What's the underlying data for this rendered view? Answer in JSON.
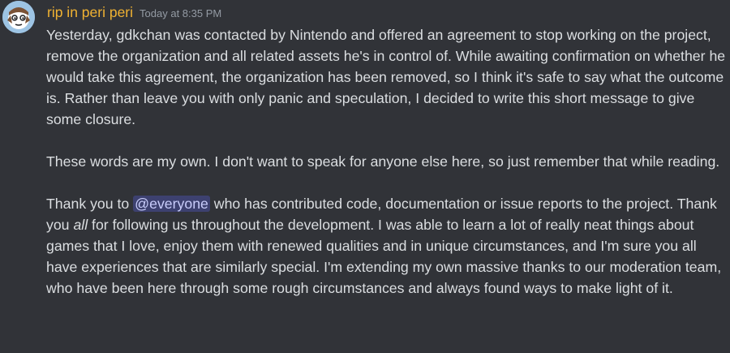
{
  "message": {
    "author": {
      "name": "rip in peri peri",
      "name_color": "#f0b232",
      "avatar_icon": "cartoon-face-avatar"
    },
    "timestamp": "Today at 8:35 PM",
    "paragraphs": {
      "p1": "Yesterday, gdkchan was contacted by Nintendo and offered an agreement to stop working on the project, remove the organization and all related assets he's in control of. While awaiting confirmation on whether he would take this agreement, the organization has been removed, so I think it's safe to say what the outcome is. Rather than leave you with only panic and speculation, I decided to write this short message to give some closure.",
      "p2": "These words are my own. I don't want to speak for anyone else here, so just remember that while reading.",
      "p3": {
        "before_mention": "Thank you to ",
        "mention": "@everyone",
        "after_mention": " who has contributed code, documentation or issue reports to the project. Thank you ",
        "emphasis": "all",
        "after_emphasis": " for following us throughout the development. I was able to learn a lot of really neat things about games that I love, enjoy them with renewed qualities and in unique circumstances, and I'm sure you all have experiences that are similarly special. I'm extending my own massive thanks to our moderation team, who have been here through some rough circumstances and always found ways to make light of it."
      }
    }
  },
  "colors": {
    "background": "#313338",
    "text": "#dbdee1",
    "timestamp": "#949ba4",
    "mention_bg": "rgba(88,101,242,0.3)",
    "mention_text": "#c9cdfb"
  }
}
